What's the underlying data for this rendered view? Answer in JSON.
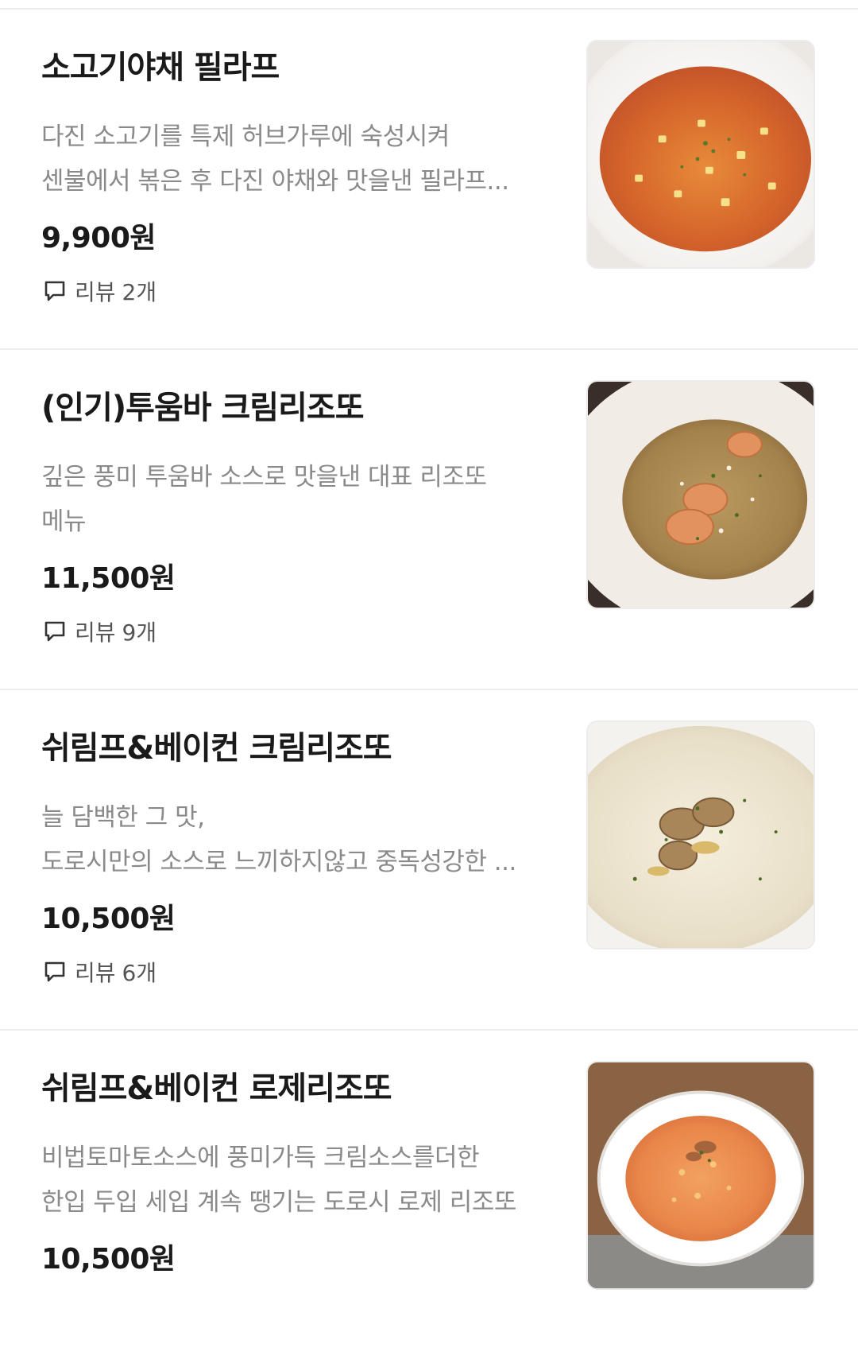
{
  "menu": {
    "items": [
      {
        "name": "소고기야채 필라프",
        "description_lines": [
          "다진 소고기를 특제 허브가루에 숙성시켜",
          "센불에서 볶은 후 다진 야채와 맛을낸 필라프..."
        ],
        "price": "9,900원",
        "review_label": "리뷰",
        "review_count": "2개",
        "image_icon": "beef-vegetable-pilaf-photo"
      },
      {
        "name": "(인기)투움바 크림리조또",
        "description_lines": [
          "깊은 풍미 투움바 소스로 맛을낸 대표 리조또",
          "메뉴"
        ],
        "price": "11,500원",
        "review_label": "리뷰",
        "review_count": "9개",
        "image_icon": "toowoomba-risotto-photo"
      },
      {
        "name": "쉬림프&베이컨 크림리조또",
        "description_lines": [
          "늘 담백한 그 맛,",
          "도로시만의 소스로 느끼하지않고 중독성강한 ..."
        ],
        "price": "10,500원",
        "review_label": "리뷰",
        "review_count": "6개",
        "image_icon": "shrimp-bacon-cream-risotto-photo"
      },
      {
        "name": "쉬림프&베이컨 로제리조또",
        "description_lines": [
          "비법토마토소스에 풍미가득 크림소스를더한",
          "한입 두입 세입 계속 땡기는 도로시 로제 리조또"
        ],
        "price": "10,500원",
        "image_icon": "shrimp-bacon-rose-risotto-photo"
      }
    ]
  },
  "colors": {
    "text_primary": "#1a1a1a",
    "text_secondary": "#8a8a8a",
    "divider": "#ededed"
  }
}
